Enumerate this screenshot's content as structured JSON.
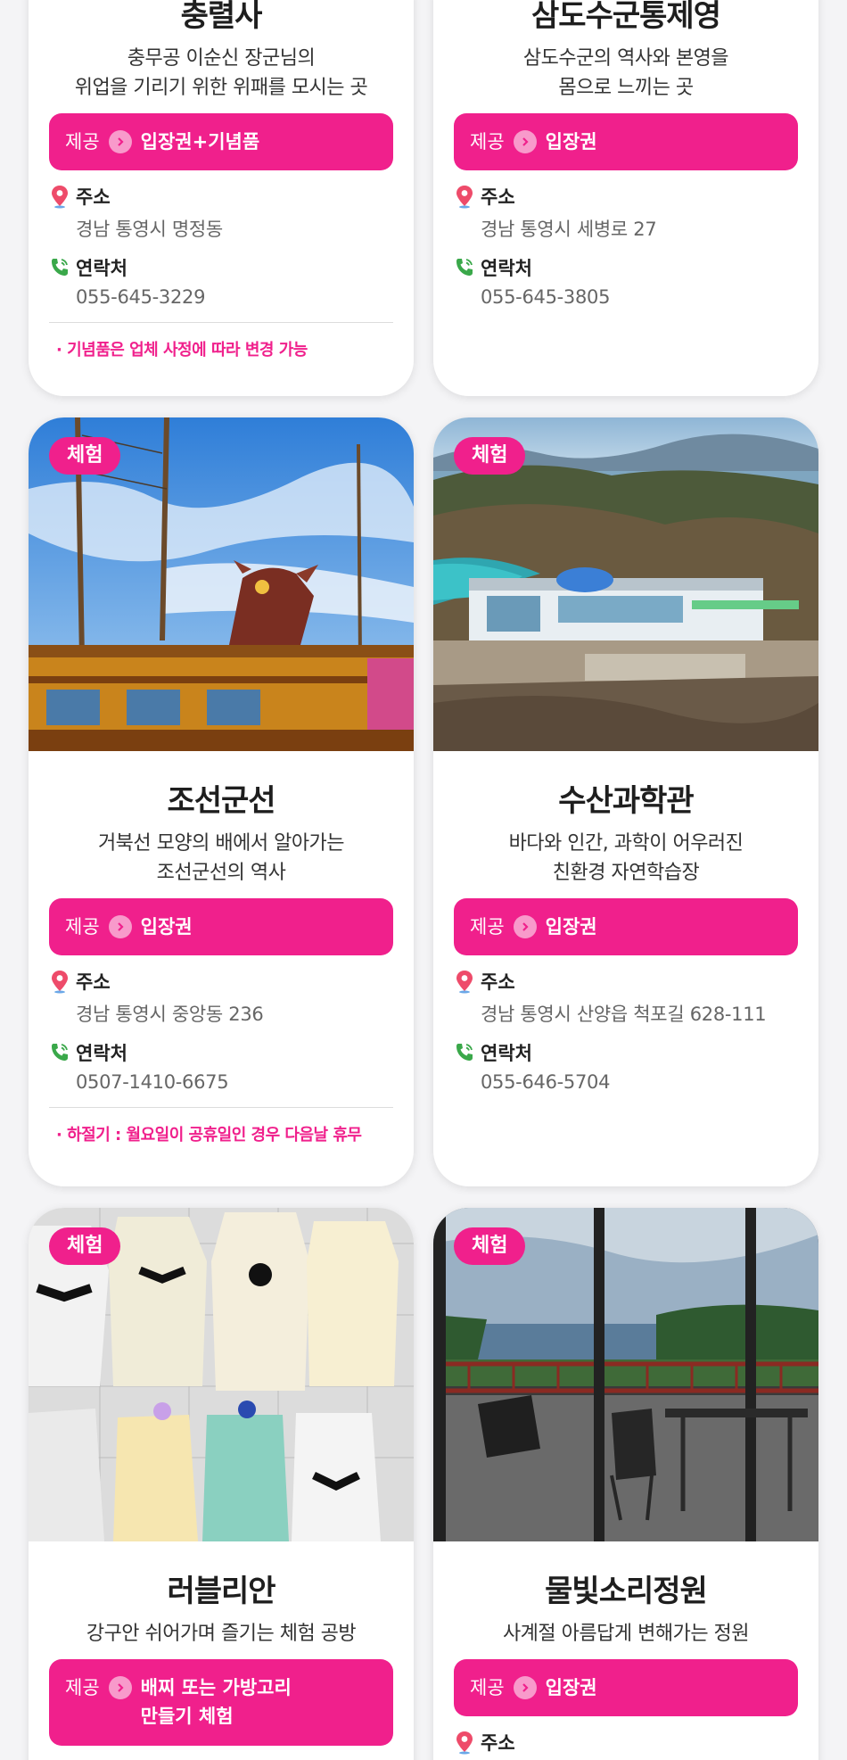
{
  "colors": {
    "accent": "#f0208c",
    "card_bg": "#ffffff",
    "page_bg": "#f4f4f6"
  },
  "labels": {
    "provide": "제공",
    "address": "주소",
    "contact": "연락처"
  },
  "cards": [
    {
      "title": "충렬사",
      "desc": [
        "충무공 이순신 장군님의",
        "위업을 기리기 위한 위패를 모시는 곳"
      ],
      "provide": "입장권+기념품",
      "address": "경남 통영시 명정동",
      "phone": "055-645-3229",
      "note": "· 기념품은 업체 사정에 따라 변경 가능"
    },
    {
      "title": "삼도수군통제영",
      "desc": [
        "삼도수군의 역사와 본영을",
        "몸으로 느끼는 곳"
      ],
      "provide": "입장권",
      "address": "경남 통영시 세병로 27",
      "phone": "055-645-3805"
    },
    {
      "tag": "체험",
      "image": "turtle-ship-photo",
      "title": "조선군선",
      "desc": [
        "거북선 모양의 배에서 알아가는",
        "조선군선의 역사"
      ],
      "provide": "입장권",
      "address": "경남 통영시 중앙동 236",
      "phone": "0507-1410-6675",
      "note": "· 하절기 : 월요일이 공휴일인 경우 다음날 휴무"
    },
    {
      "tag": "체험",
      "image": "fisheries-science-museum-photo",
      "title": "수산과학관",
      "desc": [
        "바다와 인간, 과학이 어우러진",
        "친환경 자연학습장"
      ],
      "provide": "입장권",
      "address": "경남 통영시 산양읍 척포길 628-111",
      "phone": "055-646-5704"
    },
    {
      "tag": "체험",
      "image": "baby-dresses-photo",
      "title": "러블리안",
      "desc": [
        "강구안 쉬어가며 즐기는 체험 공방"
      ],
      "provide": "배찌 또는 가방고리\n만들기 체험"
    },
    {
      "tag": "체험",
      "image": "garden-terrace-photo",
      "title": "물빛소리정원",
      "desc": [
        "사계절 아름답게 변해가는 정원"
      ],
      "provide": "입장권",
      "address_label_only": true
    }
  ]
}
